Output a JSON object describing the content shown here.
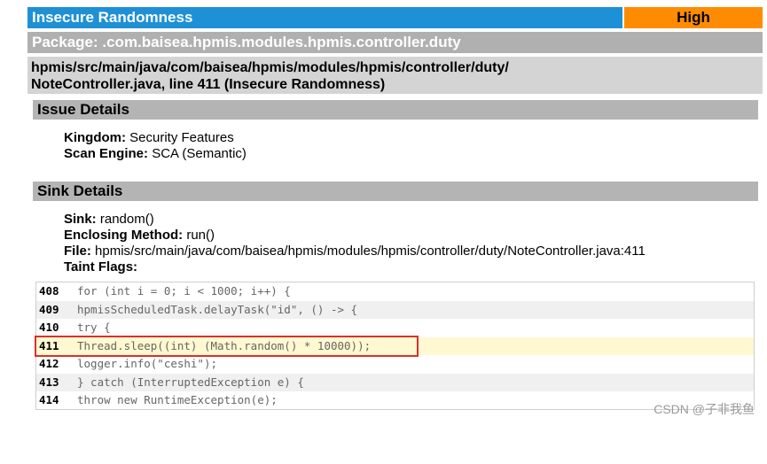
{
  "header": {
    "title": "Insecure Randomness",
    "severity": "High"
  },
  "package": "Package: .com.baisea.hpmis.modules.hpmis.controller.duty",
  "location": {
    "line1": "hpmis/src/main/java/com/baisea/hpmis/modules/hpmis/controller/duty/",
    "line2": "NoteController.java, line 411 (Insecure Randomness)"
  },
  "issue_details": {
    "heading": "Issue Details",
    "kingdom_label": "Kingdom:",
    "kingdom_value": " Security Features",
    "engine_label": "Scan Engine:",
    "engine_value": " SCA (Semantic)"
  },
  "sink_details": {
    "heading": "Sink Details",
    "sink_label": "Sink:",
    "sink_value": " random()",
    "method_label": "Enclosing Method:",
    "method_value": " run()",
    "file_label": "File:",
    "file_value": " hpmis/src/main/java/com/baisea/hpmis/modules/hpmis/controller/duty/NoteController.java:411",
    "taint_label": "Taint Flags:"
  },
  "code": [
    {
      "line": "408",
      "text": "for (int i = 0; i < 1000; i++) {"
    },
    {
      "line": "409",
      "text": "hpmisScheduledTask.delayTask(\"id\", () -> {"
    },
    {
      "line": "410",
      "text": "try {"
    },
    {
      "line": "411",
      "text": "Thread.sleep((int) (Math.random() * 10000));"
    },
    {
      "line": "412",
      "text": "logger.info(\"ceshi\");"
    },
    {
      "line": "413",
      "text": "} catch (InterruptedException e) {"
    },
    {
      "line": "414",
      "text": "throw new RuntimeException(e);"
    }
  ],
  "watermark": "CSDN @子非我鱼"
}
